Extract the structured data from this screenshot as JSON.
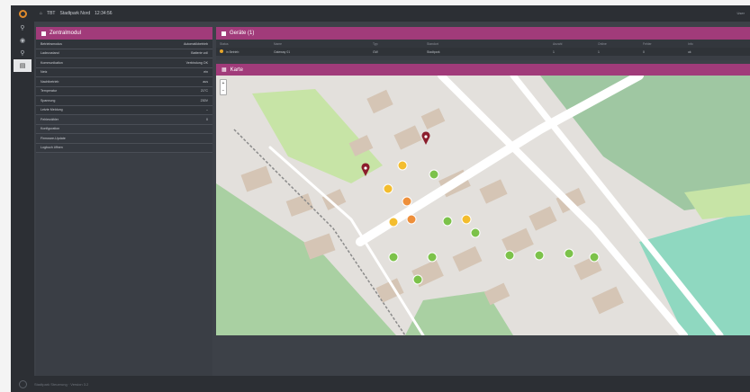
{
  "topbar": {
    "breadcrumb": [
      "⌂",
      "TBT",
      "Stadtpark Nord",
      "12:34:56"
    ],
    "right_text": "User"
  },
  "iconbar": {
    "items": [
      {
        "icon": "⚲",
        "name": "locate-icon"
      },
      {
        "icon": "◉",
        "name": "camera-icon"
      },
      {
        "icon": "⚲",
        "name": "pin-icon"
      },
      {
        "icon": "▤",
        "name": "list-icon"
      }
    ]
  },
  "left_panel": {
    "title": "Zentralmodul",
    "rows": [
      {
        "label": "Betriebsmodus",
        "value": "Automatikbetrieb"
      },
      {
        "label": "Ladezustand",
        "value": "Batterie voll"
      },
      {
        "label": "Kommunikation",
        "value": "Verbindung OK"
      },
      {
        "label": "Netz",
        "value": "ein"
      },
      {
        "label": "Nachtbetrieb",
        "value": "aus"
      },
      {
        "label": "Temperatur",
        "value": "21°C"
      },
      {
        "label": "Spannung",
        "value": "230V"
      },
      {
        "label": "Letzte Meldung",
        "value": "–"
      },
      {
        "label": "Fehlerzähler",
        "value": "0"
      },
      {
        "label": "Konfiguration",
        "value": ""
      },
      {
        "label": "Firmware-Update",
        "value": ""
      },
      {
        "label": "Logbuch öffnen",
        "value": ""
      }
    ]
  },
  "devices_panel": {
    "title": "Geräte (1)",
    "columns": [
      "Status",
      "Name",
      "Typ",
      "Standort",
      "Anzahl",
      "Online",
      "Fehler",
      "Info"
    ],
    "rows": [
      [
        "in Betrieb",
        "Gateway 01",
        "GW",
        "Stadtpark",
        "1",
        "1",
        "0",
        "ok"
      ]
    ]
  },
  "map_panel": {
    "title": "Karte",
    "zoom_in": "+",
    "zoom_out": "−",
    "markers": [
      {
        "kind": "pin"
      },
      {
        "kind": "pin"
      },
      {
        "kind": "amber"
      },
      {
        "kind": "amber"
      },
      {
        "kind": "amber"
      },
      {
        "kind": "amber"
      },
      {
        "kind": "orange"
      },
      {
        "kind": "orange"
      },
      {
        "kind": "green"
      },
      {
        "kind": "green"
      },
      {
        "kind": "green"
      },
      {
        "kind": "green"
      },
      {
        "kind": "green"
      },
      {
        "kind": "green"
      },
      {
        "kind": "green"
      },
      {
        "kind": "green"
      },
      {
        "kind": "green"
      },
      {
        "kind": "green"
      }
    ]
  },
  "footer": {
    "text": "Stadtpark Steuerung · Version 3.2"
  },
  "colors": {
    "accent": "#a13b7a",
    "marker_green": "#7cc24a",
    "marker_amber": "#f3bd2e",
    "marker_orange": "#ee8f3a",
    "marker_pin": "#8b1d2c"
  }
}
